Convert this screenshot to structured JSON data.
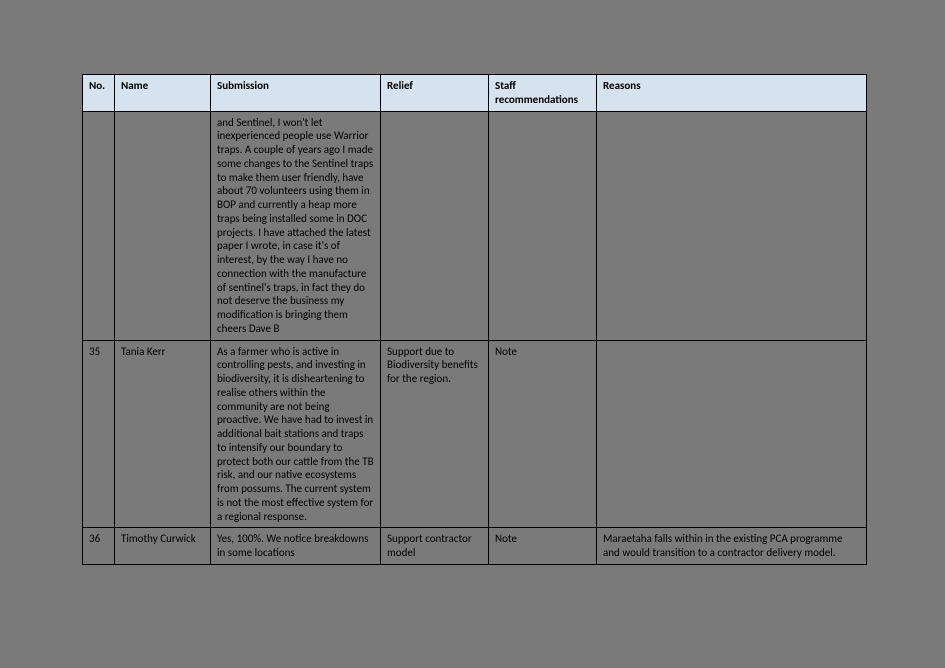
{
  "headers": {
    "no": "No.",
    "name": "Name",
    "submission": "Submission",
    "relief": "Relief",
    "staff": "Staff recommendations",
    "reasons": "Reasons"
  },
  "rows": [
    {
      "no": "",
      "name": "",
      "submission": "and Sentinel, I won't let inexperienced people use Warrior traps.  A couple of years ago I made some changes to the Sentinel traps to make them user friendly, have about 70 volunteers using them in BOP and currently a heap more traps being installed some in DOC projects. I have attached the latest paper I wrote, in case it's of interest, by the way I have no connection with the manufacture of sentinel's traps, in fact they do not deserve the business my modification is bringing them cheers Dave B",
      "relief": "",
      "staff": "",
      "reasons": ""
    },
    {
      "no": "35",
      "name": "Tania Kerr",
      "submission": "As a farmer who is active in controlling pests, and investing in biodiversity, it is disheartening to realise others within the community are not being proactive. We have had to invest in additional bait stations and traps to intensify our boundary to protect both our cattle from the TB risk, and our native ecosystems from possums. The current system is not the most effective system for a regional response.",
      "relief": "Support due to Biodiversity benefits for the region.",
      "staff": "Note",
      "reasons": ""
    },
    {
      "no": "36",
      "name": "Timothy Curwick",
      "submission": "Yes, 100%. We notice breakdowns in some locations",
      "relief": "Support contractor model",
      "staff": "Note",
      "reasons": "Maraetaha falls within in the existing PCA programme and would transition to a contractor delivery model."
    }
  ]
}
